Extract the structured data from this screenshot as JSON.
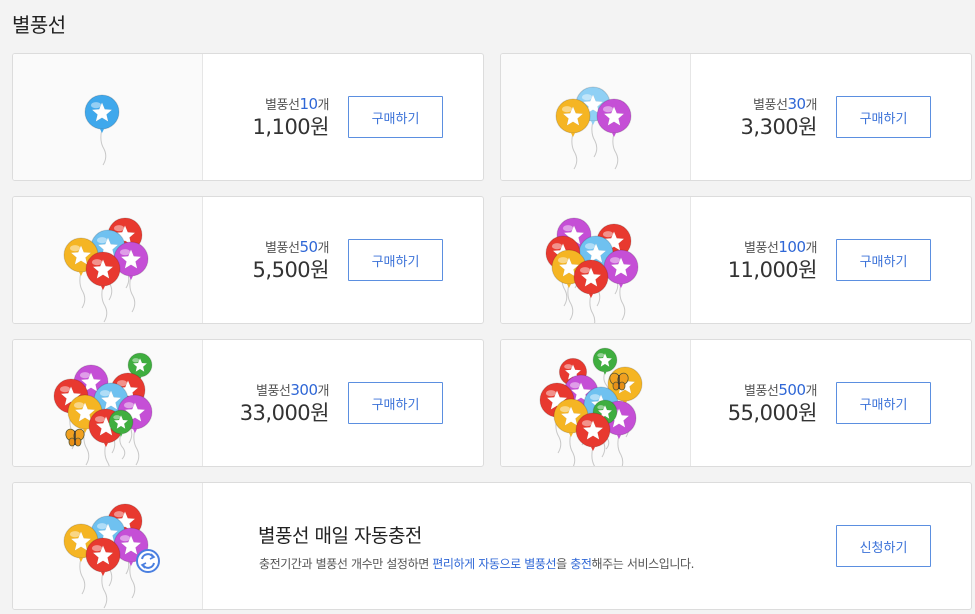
{
  "page": {
    "title": "별풍선"
  },
  "colors": {
    "accent": "#3b72d8",
    "count_blue": "#2f67d6"
  },
  "products": [
    {
      "label": "별풍선",
      "count": "10",
      "unit": "개",
      "price": "1,100원",
      "button": "구매하기"
    },
    {
      "label": "별풍선",
      "count": "30",
      "unit": "개",
      "price": "3,300원",
      "button": "구매하기"
    },
    {
      "label": "별풍선",
      "count": "50",
      "unit": "개",
      "price": "5,500원",
      "button": "구매하기"
    },
    {
      "label": "별풍선",
      "count": "100",
      "unit": "개",
      "price": "11,000원",
      "button": "구매하기"
    },
    {
      "label": "별풍선",
      "count": "300",
      "unit": "개",
      "price": "33,000원",
      "button": "구매하기"
    },
    {
      "label": "별풍선",
      "count": "500",
      "unit": "개",
      "price": "55,000원",
      "button": "구매하기"
    }
  ],
  "auto_charge": {
    "title": "별풍선 매일 자동충전",
    "desc_part1": "충전기간과 별풍선 개수만 설정하면 ",
    "desc_highlight1": "편리하게 자동으로 별풍선",
    "desc_part2": "을 ",
    "desc_highlight2": "충전",
    "desc_part3": "해주는 서비스입니다.",
    "button": "신청하기"
  },
  "icons": {
    "balloon": "star-balloon-icon",
    "butterfly": "butterfly-icon",
    "refresh": "refresh-icon"
  }
}
